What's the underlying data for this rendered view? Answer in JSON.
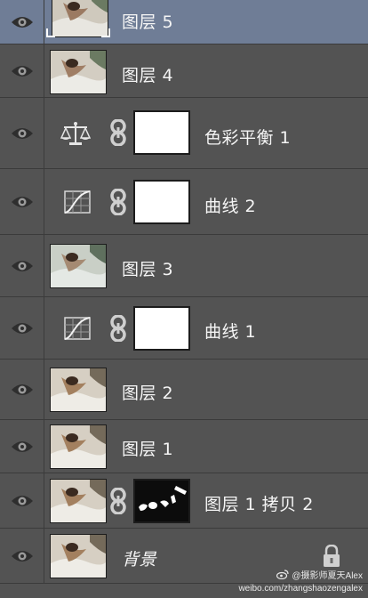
{
  "layers": [
    {
      "name": "图层 5",
      "type": "pixel",
      "visible": true,
      "selected": true
    },
    {
      "name": "图层 4",
      "type": "pixel",
      "visible": true
    },
    {
      "name": "色彩平衡 1",
      "type": "adjustment",
      "icon": "balance-icon",
      "visible": true
    },
    {
      "name": "曲线 2",
      "type": "adjustment",
      "icon": "curves-icon",
      "visible": true
    },
    {
      "name": "图层 3",
      "type": "pixel",
      "visible": true
    },
    {
      "name": "曲线 1",
      "type": "adjustment",
      "icon": "curves-icon",
      "visible": true
    },
    {
      "name": "图层 2",
      "type": "pixel",
      "visible": true
    },
    {
      "name": "图层 1",
      "type": "pixel",
      "visible": true
    },
    {
      "name": "图层 1 拷贝 2",
      "type": "pixel-with-mask",
      "visible": true
    },
    {
      "name": "背景",
      "type": "background",
      "visible": true,
      "locked": true
    }
  ],
  "colors": {
    "panel_bg": "#535353",
    "selected_bg": "#6f7d96",
    "divider": "#3b3b3b"
  },
  "watermark": {
    "handle": "@摄影师夏天Alex",
    "url": "weibo.com/zhangshaozengalex",
    "icon": "weibo-icon"
  }
}
